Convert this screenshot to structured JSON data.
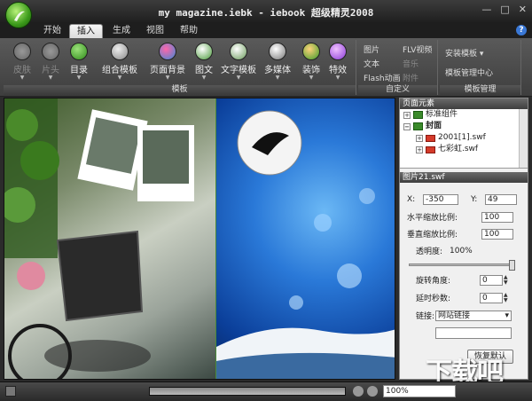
{
  "titlebar": {
    "title": "my magazine.iebk - iebook 超级精灵2008",
    "min": "—",
    "max": "□",
    "close": "✕"
  },
  "tabs": [
    "开始",
    "插入",
    "生成",
    "视图",
    "帮助"
  ],
  "help": "?",
  "ribbon": {
    "group1": {
      "label": "模板",
      "buttons": [
        "皮肤",
        "片头",
        "目录",
        "组合模板",
        "页面背景",
        "图文",
        "文字模板",
        "多媒体",
        "装饰",
        "特效"
      ]
    },
    "group2": {
      "label": "自定义",
      "items": [
        "图片",
        "FLV视频",
        "文本",
        "音乐",
        "Flash动画",
        "附件"
      ]
    },
    "group3": {
      "label": "模板管理",
      "items": [
        "安装模板",
        "模板管理中心"
      ]
    }
  },
  "colors": {
    "accent": "#3b9a1a",
    "ribbon": "#4a4a4a",
    "panel": "#f0f0f0"
  },
  "panel": {
    "elements_title": "页面元素",
    "tree": [
      "标准组件",
      "封面",
      "2001[1].swf",
      "七彩虹.swf",
      "图片21.swf"
    ],
    "props_title": "图片21.swf",
    "x_label": "X:",
    "x_value": "-350",
    "y_label": "Y:",
    "y_value": "49",
    "hscale_label": "水平缩放比例:",
    "hscale_value": "100",
    "vscale_label": "垂直缩放比例:",
    "vscale_value": "100",
    "opacity_label": "透明度:",
    "opacity_value": "100%",
    "rotate_label": "旋转角度:",
    "rotate_value": "0",
    "delay_label": "延时秒数:",
    "delay_value": "0",
    "link_label": "链接:",
    "link_value": "网站链接",
    "restore_label": "恢复默认"
  },
  "statusbar": {
    "zoom": "100%"
  },
  "watermark": "下载吧"
}
